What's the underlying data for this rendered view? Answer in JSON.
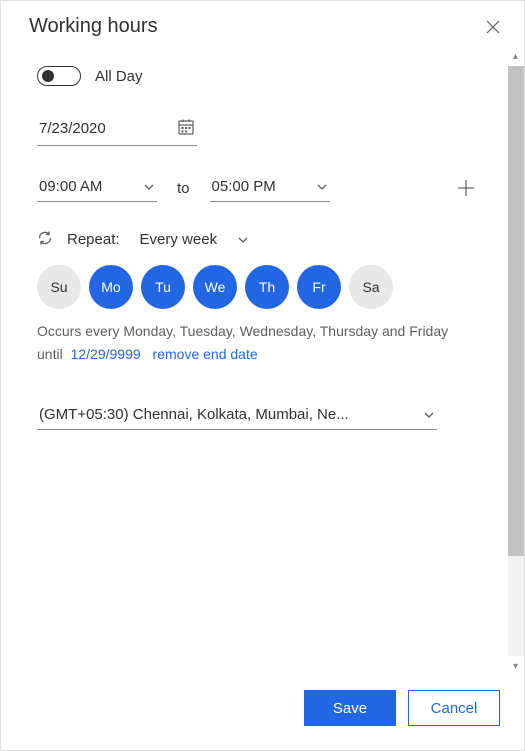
{
  "header": {
    "title": "Working hours"
  },
  "allDay": {
    "label": "All Day",
    "checked": false
  },
  "date": {
    "value": "7/23/2020"
  },
  "time": {
    "start": "09:00 AM",
    "toLabel": "to",
    "end": "05:00 PM"
  },
  "repeat": {
    "label": "Repeat:",
    "value": "Every week"
  },
  "days": [
    {
      "abbr": "Su",
      "selected": false
    },
    {
      "abbr": "Mo",
      "selected": true
    },
    {
      "abbr": "Tu",
      "selected": true
    },
    {
      "abbr": "We",
      "selected": true
    },
    {
      "abbr": "Th",
      "selected": true
    },
    {
      "abbr": "Fr",
      "selected": true
    },
    {
      "abbr": "Sa",
      "selected": false
    }
  ],
  "occurrence": {
    "text": "Occurs every Monday, Tuesday, Wednesday, Thursday and Friday",
    "untilLabel": "until",
    "untilDate": "12/29/9999",
    "removeLabel": "remove end date"
  },
  "timezone": {
    "value": "(GMT+05:30) Chennai, Kolkata, Mumbai, Ne..."
  },
  "footer": {
    "save": "Save",
    "cancel": "Cancel"
  }
}
